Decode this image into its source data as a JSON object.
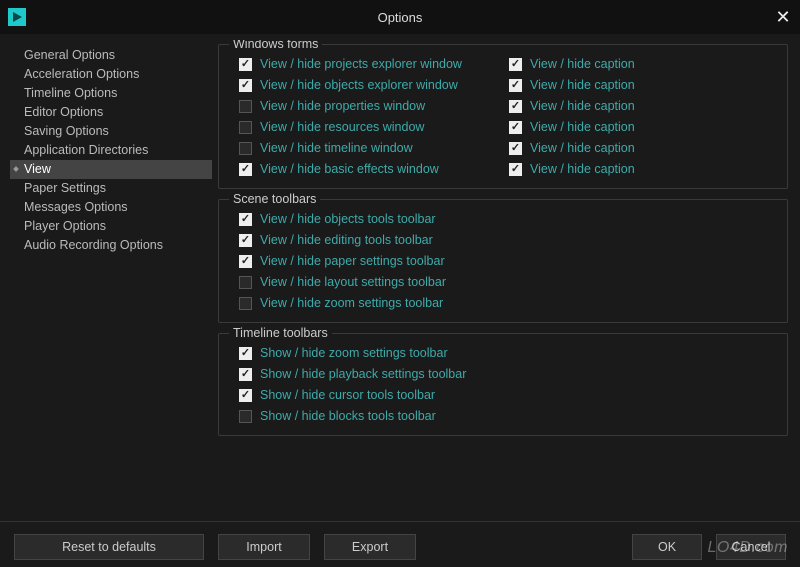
{
  "title": "Options",
  "sidebar": {
    "items": [
      {
        "label": "General Options"
      },
      {
        "label": "Acceleration Options"
      },
      {
        "label": "Timeline Options"
      },
      {
        "label": "Editor Options"
      },
      {
        "label": "Saving Options"
      },
      {
        "label": "Application Directories"
      },
      {
        "label": "View",
        "selected": true
      },
      {
        "label": "Paper Settings"
      },
      {
        "label": "Messages Options"
      },
      {
        "label": "Player Options"
      },
      {
        "label": "Audio Recording Options"
      }
    ]
  },
  "groups": {
    "windowsForms": {
      "title": "Windows forms",
      "left": [
        {
          "label": "View / hide projects explorer window",
          "checked": true
        },
        {
          "label": "View / hide objects explorer window",
          "checked": true
        },
        {
          "label": "View / hide properties window",
          "checked": false
        },
        {
          "label": "View / hide resources window",
          "checked": false
        },
        {
          "label": "View / hide timeline window",
          "checked": false
        },
        {
          "label": "View / hide basic effects window",
          "checked": true
        }
      ],
      "right": [
        {
          "label": "View / hide caption",
          "checked": true
        },
        {
          "label": "View / hide caption",
          "checked": true
        },
        {
          "label": "View / hide caption",
          "checked": true
        },
        {
          "label": "View / hide caption",
          "checked": true
        },
        {
          "label": "View / hide caption",
          "checked": true
        },
        {
          "label": "View / hide caption",
          "checked": true
        }
      ]
    },
    "sceneToolbars": {
      "title": "Scene toolbars",
      "items": [
        {
          "label": "View / hide objects tools toolbar",
          "checked": true
        },
        {
          "label": "View / hide editing tools toolbar",
          "checked": true
        },
        {
          "label": "View / hide paper settings toolbar",
          "checked": true
        },
        {
          "label": "View / hide layout settings toolbar",
          "checked": false
        },
        {
          "label": "View / hide zoom settings toolbar",
          "checked": false
        }
      ]
    },
    "timelineToolbars": {
      "title": "Timeline toolbars",
      "items": [
        {
          "label": "Show / hide zoom settings toolbar",
          "checked": true
        },
        {
          "label": "Show / hide playback settings toolbar",
          "checked": true
        },
        {
          "label": "Show / hide cursor tools toolbar",
          "checked": true
        },
        {
          "label": "Show / hide blocks tools toolbar",
          "checked": false
        }
      ]
    }
  },
  "footer": {
    "reset": "Reset to defaults",
    "import": "Import",
    "export": "Export",
    "ok": "OK",
    "cancel": "Cancel"
  },
  "watermark": "LO4D.com"
}
